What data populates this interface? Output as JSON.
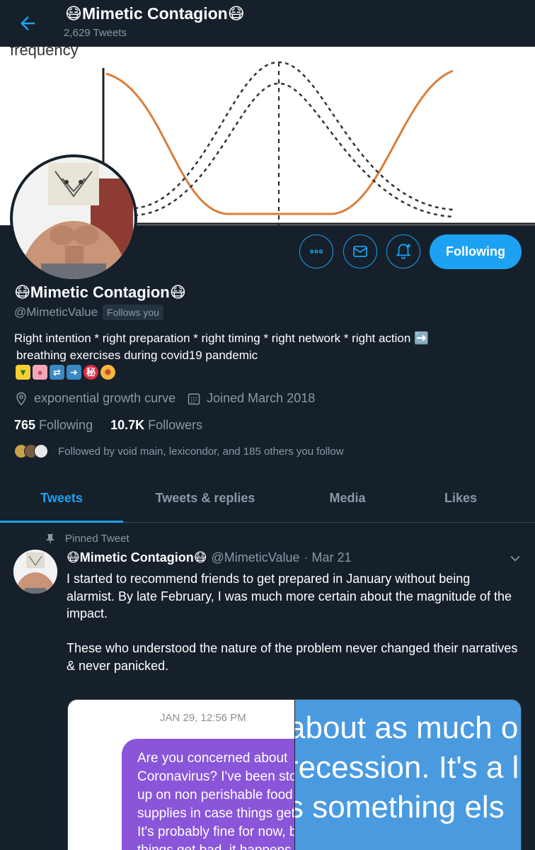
{
  "header": {
    "title": "😷Mimetic Contagion😷",
    "tweet_count": "2,629 Tweets"
  },
  "banner": {
    "label": "frequency",
    "curve_color": "#d97f3a"
  },
  "profile": {
    "name": "😷Mimetic Contagion😷",
    "handle": "@MimeticValue",
    "follows_you": "Follows you",
    "bio_line1": "Right intention * right preparation * right timing * right network * right action ➡️",
    "bio_line2": "breathing exercises during covid19 pandemic",
    "bio_emojis": [
      "🔰",
      "🧠",
      "🔁",
      "➡️",
      "㊙️",
      "🤯"
    ],
    "location": "exponential growth curve",
    "joined": "Joined March 2018",
    "following_count": "765",
    "following_label": "Following",
    "followers_count": "10.7K",
    "followers_label": "Followers",
    "followed_by": "Followed by void main, lexicondor, and 185 others you follow"
  },
  "actions": {
    "follow_label": "Following",
    "more_icon": "more-icon",
    "message_icon": "mail-icon",
    "notify_icon": "bell-plus-icon"
  },
  "tabs": [
    {
      "label": "Tweets",
      "active": true
    },
    {
      "label": "Tweets & replies",
      "active": false
    },
    {
      "label": "Media",
      "active": false
    },
    {
      "label": "Likes",
      "active": false
    }
  ],
  "tweet": {
    "pinned_label": "Pinned Tweet",
    "name": "😷Mimetic Contagion😷",
    "handle": "@MimeticValue",
    "date": "· Mar 21",
    "text_p1": "I started to recommend friends to get prepared in January without being alarmist. By late February, I was much more certain about the magnitude of the impact.",
    "text_p2": "These who understood the nature of the problem never changed their narratives & never panicked.",
    "media": {
      "timestamp": "JAN 29, 12:56 PM",
      "bubble_text": "Are you concerned about Coronavirus? I've been stocking up on non perishable food and supplies in case things get bad. It's probably fine for now, but if things get bad, it happens super",
      "right_lines": [
        "about as much o",
        "recession. It's a l",
        "s something els"
      ]
    }
  },
  "colors": {
    "background": "#15202b",
    "accent": "#1da1f2",
    "muted": "#8899a6",
    "bubble": "#8a55d9",
    "right_panel": "#4a9ae0"
  }
}
